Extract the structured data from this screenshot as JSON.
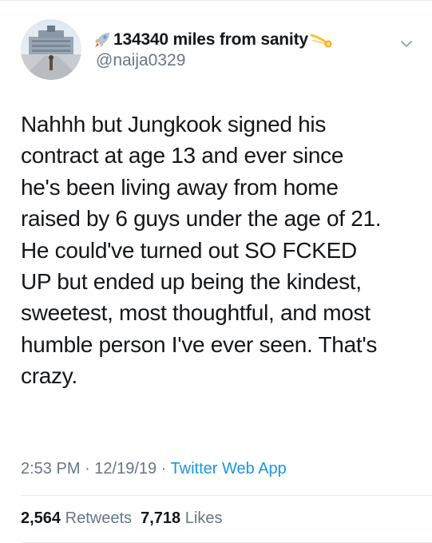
{
  "author": {
    "display_name": "134340 miles from sanity",
    "handle": "@naija0329",
    "name_prefix_icon": "rocket-icon",
    "name_suffix_icon": "comet-icon",
    "avatar": "profile-photo"
  },
  "tweet": {
    "lines": [
      "Nahhh but Jungkook signed his",
      "contract at age 13 and ever since",
      "he's been living away from home",
      "raised by 6 guys under the age of 21.",
      "He could've turned out SO FCKED",
      "UP but ended up being the kindest,",
      "sweetest, most thoughtful, and most",
      "humble person I've ever seen. That's",
      "crazy."
    ]
  },
  "meta": {
    "time": "2:53 PM",
    "separator": " · ",
    "date": "12/19/19",
    "source": "Twitter Web App"
  },
  "stats": {
    "retweets_count": "2,564",
    "retweets_label": "Retweets",
    "likes_count": "7,718",
    "likes_label": "Likes"
  },
  "colors": {
    "text": "#14171a",
    "secondary": "#657786",
    "link": "#1b95e0",
    "divider": "#e6ecf0"
  }
}
